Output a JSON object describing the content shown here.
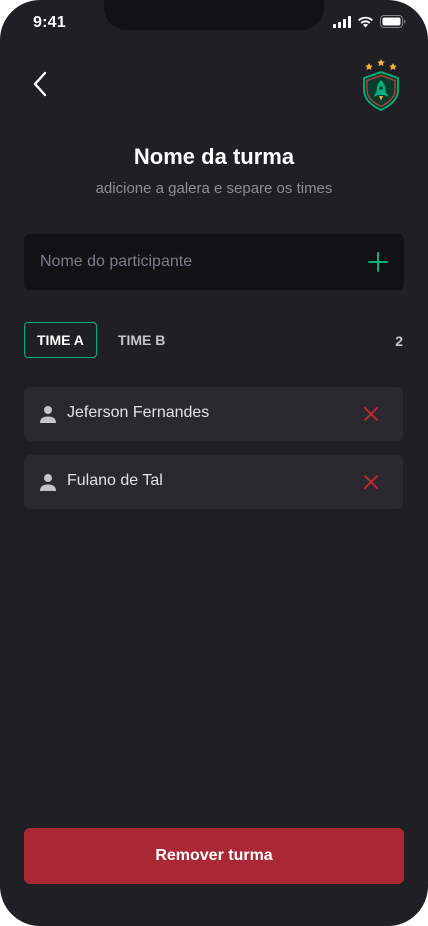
{
  "status_bar": {
    "time": "9:41"
  },
  "header": {
    "back_icon": "chevron-left-icon",
    "logo_icon": "rocket-shield-logo"
  },
  "page": {
    "title": "Nome da turma",
    "subtitle": "adicione a galera e separe os times"
  },
  "participant_input": {
    "placeholder": "Nome do participante",
    "value": "",
    "add_icon": "plus-icon"
  },
  "tabs": [
    {
      "label": "TIME A",
      "active": true
    },
    {
      "label": "TIME B",
      "active": false
    }
  ],
  "player_count": "2",
  "players": [
    {
      "name": "Jeferson Fernandes"
    },
    {
      "name": "Fulano de Tal"
    }
  ],
  "footer": {
    "remove_label": "Remover turma"
  },
  "colors": {
    "background": "#202024",
    "input_bg": "#121214",
    "card_bg": "#29292e",
    "accent_green": "#00b37e",
    "danger_red": "#aa2834",
    "remove_icon_red": "#cc2937"
  }
}
